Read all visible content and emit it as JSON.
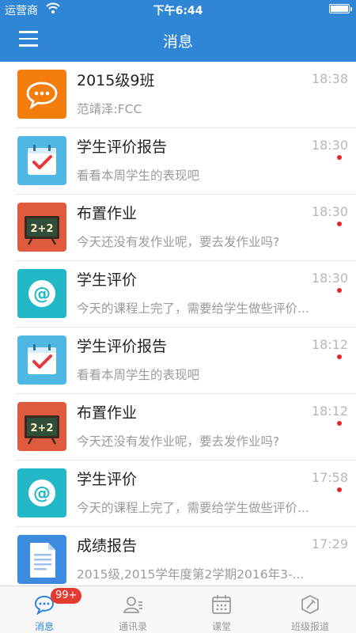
{
  "status_bar": {
    "carrier": "运营商",
    "time": "下午6:44"
  },
  "header": {
    "title": "消息"
  },
  "messages": [
    {
      "name": "2015级9班",
      "time": "18:38",
      "preview": "范靖泽:FCC",
      "unread": false,
      "icon": "chat-bubble-icon"
    },
    {
      "name": "学生评价报告",
      "time": "18:30",
      "preview": "看看本周学生的表现吧",
      "unread": true,
      "icon": "calendar-check-icon"
    },
    {
      "name": "布置作业",
      "time": "18:30",
      "preview": "今天还没有发作业呢，要去发作业吗?",
      "unread": true,
      "icon": "chalkboard-icon",
      "board_text": "2+2"
    },
    {
      "name": "学生评价",
      "time": "18:30",
      "preview": "今天的课程上完了，需要给学生做些评价...",
      "unread": true,
      "icon": "at-sign-icon"
    },
    {
      "name": "学生评价报告",
      "time": "18:12",
      "preview": "看看本周学生的表现吧",
      "unread": true,
      "icon": "calendar-check-icon"
    },
    {
      "name": "布置作业",
      "time": "18:12",
      "preview": "今天还没有发作业呢，要去发作业吗?",
      "unread": true,
      "icon": "chalkboard-icon",
      "board_text": "2+2"
    },
    {
      "name": "学生评价",
      "time": "17:58",
      "preview": "今天的课程上完了，需要给学生做些评价...",
      "unread": true,
      "icon": "at-sign-icon"
    },
    {
      "name": "成绩报告",
      "time": "17:29",
      "preview": "2015级,2015学年度第2学期2016年3-...",
      "unread": false,
      "icon": "document-icon"
    }
  ],
  "tabs": [
    {
      "label": "消息",
      "icon": "chat-icon",
      "active": true,
      "badge": "99+"
    },
    {
      "label": "通讯录",
      "icon": "contacts-icon",
      "active": false
    },
    {
      "label": "课堂",
      "icon": "calendar-grid-icon",
      "active": false
    },
    {
      "label": "班级报道",
      "icon": "edit-report-icon",
      "active": false
    }
  ],
  "colors": {
    "primary": "#2f86d6",
    "unread_dot": "#e0282a",
    "badge": "#e33a32",
    "chat_icon_bg": "#f47d0f",
    "calendar_icon_bg": "#4fb7e4",
    "chalkboard_icon_bg": "#e05a40",
    "at_icon_bg": "#23b8c8",
    "document_icon_bg": "#3d8be0"
  }
}
